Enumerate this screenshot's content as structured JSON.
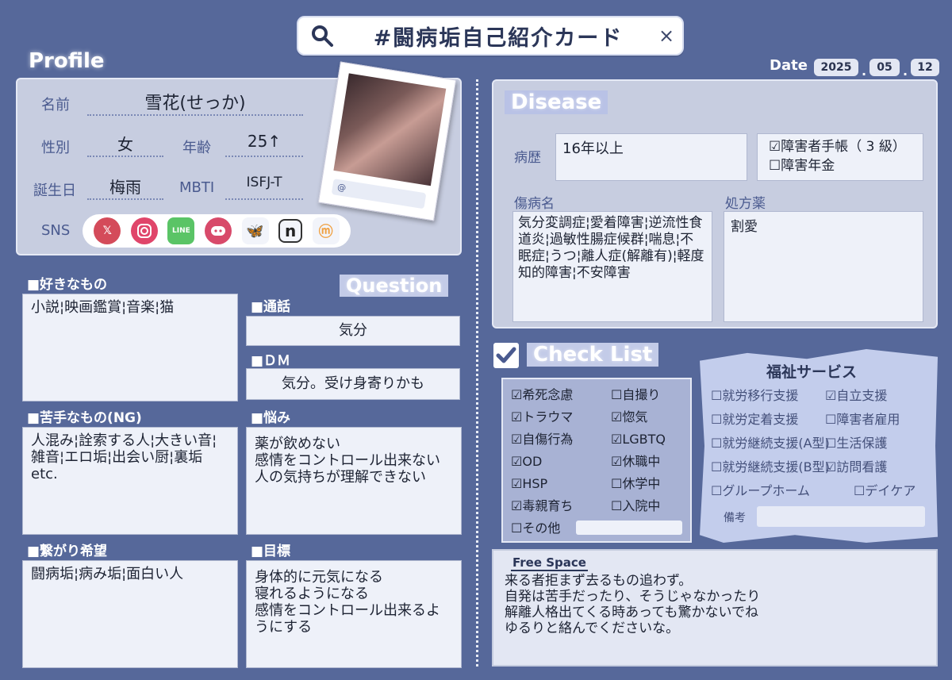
{
  "header": {
    "title": "#闘病垢自己紹介カード",
    "close_label": "×"
  },
  "profile": {
    "heading": "Profile",
    "name_label": "名前",
    "name_value": "雪花(せっか)",
    "gender_label": "性別",
    "gender_value": "女",
    "age_label": "年齢",
    "age_value": "25↑",
    "birth_label": "誕生日",
    "birth_value": "梅雨",
    "mbti_label": "MBTI",
    "mbti_value": "ISFJ-T",
    "sns_label": "SNS",
    "sns_icons": [
      "x-icon",
      "instagram-icon",
      "line-icon",
      "discord-icon",
      "bluesky-icon",
      "note-icon",
      "misskey-icon"
    ],
    "photo_handle": "@"
  },
  "date": {
    "label": "Date",
    "year": "2025",
    "month": "05",
    "day": "12"
  },
  "likes": {
    "heading": "■好きなもの",
    "text": "小説¦映画鑑賞¦音楽¦猫"
  },
  "dislikes": {
    "heading": "■苦手なもの(NG)",
    "text": "人混み¦詮索する人¦大きい音¦雑音¦エロ垢¦出会い厨¦裏垢\netc."
  },
  "connect": {
    "heading": "■繋がり希望",
    "text": "闘病垢¦病み垢¦面白い人"
  },
  "question": {
    "heading": "Question",
    "call_heading": "■通話",
    "call_value": "気分",
    "dm_heading": "■ＤＭ",
    "dm_value": "気分。受け身寄りかも",
    "worry_heading": "■悩み",
    "worry_text": "薬が飲めない\n感情をコントロール出来ない\n人の気持ちが理解できない",
    "goal_heading": "■目標",
    "goal_text": "身体的に元気になる\n寝れるようになる\n感情をコントロール出来るようにする"
  },
  "disease": {
    "heading": "Disease",
    "history_label": "病歴",
    "history_value": "16年以上",
    "cert1": "☑障害者手帳（ 3 級）",
    "cert2": "☐障害年金",
    "diag_label": "傷病名",
    "diag_text": "気分変調症¦愛着障害¦逆流性食道炎¦過敏性腸症候群¦喘息¦不眠症¦うつ¦離人症(解離有)¦軽度知的障害¦不安障害",
    "med_label": "処方薬",
    "med_text": "割愛"
  },
  "checklist": {
    "heading": "Check List",
    "left": [
      "☑希死念慮",
      "☑トラウマ",
      "☑自傷行為",
      "☑OD",
      "☑HSP",
      "☑毒親育ち",
      "☐その他"
    ],
    "right": [
      "☐自撮り",
      "☑惚気",
      "☑LGBTQ",
      "☑休職中",
      "☐休学中",
      "☐入院中"
    ]
  },
  "welfare": {
    "heading": "福祉サービス",
    "left": [
      "☐就労移行支援",
      "☐就労定着支援",
      "☐就労継続支援(A型)",
      "☐就労継続支援(B型)",
      "☐グループホーム"
    ],
    "right": [
      "☑自立支援",
      "☐障害者雇用",
      "☐生活保護",
      "☑訪問看護",
      "☐デイケア"
    ],
    "note_label": "備考"
  },
  "free": {
    "heading": "Free Space",
    "text": "来る者拒まず去るもの追わず。\n自発は苦手だったり、そうじゃなかったり\n解離人格出てくる時あっても驚かないでね\nゆるりと絡んでくださいな。"
  },
  "colors": {
    "background": "#56689a",
    "panel": "#c7cde0",
    "box": "#eef1f9",
    "accent": "#4a5a8f"
  }
}
